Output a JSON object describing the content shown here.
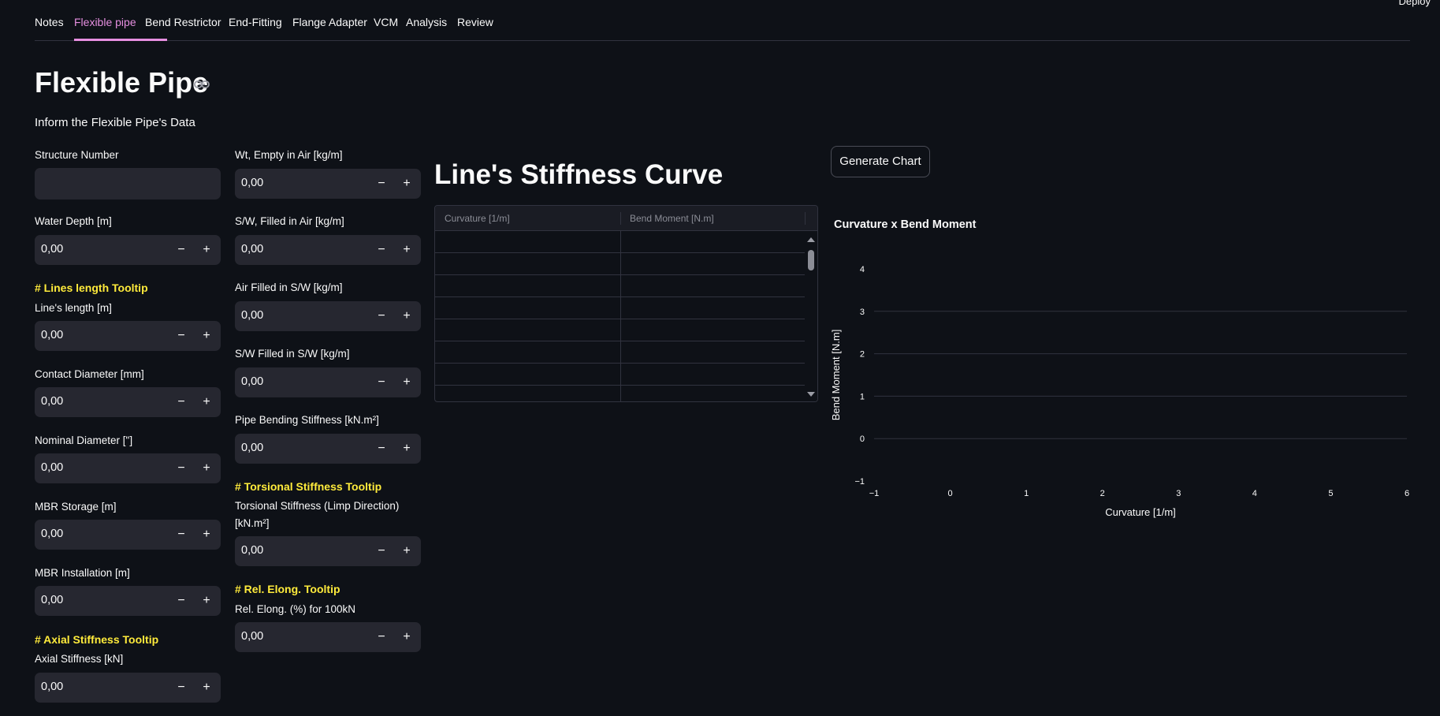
{
  "header": {
    "deploy": "Deploy"
  },
  "tabs": [
    {
      "label": "Notes",
      "active": false
    },
    {
      "label": "Flexible pipe",
      "active": true
    },
    {
      "label": "Bend Restrictor",
      "active": false
    },
    {
      "label": "End-Fitting",
      "active": false
    },
    {
      "label": "Flange Adapter",
      "active": false
    },
    {
      "label": "VCM",
      "active": false
    },
    {
      "label": "Analysis",
      "active": false
    },
    {
      "label": "Review",
      "active": false
    }
  ],
  "page": {
    "title": "Flexible Pipe",
    "subtitle": "Inform the Flexible Pipe's Data"
  },
  "left_fields": {
    "structure_number": {
      "label": "Structure Number",
      "value": ""
    },
    "water_depth": {
      "label": "Water Depth [m]",
      "value": "0,00"
    },
    "lines_tooltip": "# Lines length Tooltip",
    "lines_length": {
      "label": "Line's length [m]",
      "value": "0,00"
    },
    "contact_diameter": {
      "label": "Contact Diameter [mm]",
      "value": "0,00"
    },
    "nominal_diameter": {
      "label": "Nominal Diameter [\"]",
      "value": "0,00"
    },
    "mbr_storage": {
      "label": "MBR Storage [m]",
      "value": "0,00"
    },
    "mbr_installation": {
      "label": "MBR Installation [m]",
      "value": "0,00"
    },
    "axial_tooltip": "# Axial Stiffness Tooltip",
    "axial_stiffness": {
      "label": "Axial Stiffness [kN]",
      "value": "0,00"
    }
  },
  "right_fields": {
    "wt_empty_air": {
      "label": "Wt, Empty in Air [kg/m]",
      "value": "0,00"
    },
    "sw_filled_air": {
      "label": "S/W, Filled in Air [kg/m]",
      "value": "0,00"
    },
    "air_filled_sw": {
      "label": "Air Filled in S/W [kg/m]",
      "value": "0,00"
    },
    "sw_filled_sw": {
      "label": "S/W Filled in S/W [kg/m]",
      "value": "0,00"
    },
    "bending_stiffness": {
      "label": "Pipe Bending Stiffness [kN.m²]",
      "value": "0,00"
    },
    "torsional_tooltip": "# Torsional Stiffness Tooltip",
    "torsional_stiffness": {
      "label_line1": "Torsional Stiffness (Limp Direction)",
      "label_line2": "[kN.m²]",
      "value": "0,00"
    },
    "rel_elong_tooltip": "# Rel. Elong. Tooltip",
    "rel_elong": {
      "label": "Rel. Elong. (%) for 100kN",
      "value": "0,00"
    }
  },
  "buttons": {
    "minus": "−",
    "plus": "+",
    "generate_chart": "Generate Chart"
  },
  "stiffness": {
    "title": "Line's Stiffness Curve",
    "columns": [
      "Curvature [1/m]",
      "Bend Moment [N.m]"
    ]
  },
  "chart_data": {
    "type": "line",
    "title": "Curvature x Bend Moment",
    "xlabel": "Curvature [1/m]",
    "ylabel": "Bend Moment [N.m]",
    "x": [],
    "series": [],
    "xlim": [
      -1,
      6
    ],
    "ylim": [
      -1,
      4
    ],
    "xticks": [
      "−1",
      "0",
      "1",
      "2",
      "3",
      "4",
      "5",
      "6"
    ],
    "yticks": [
      "−1",
      "0",
      "1",
      "2",
      "3",
      "4"
    ],
    "grid": true
  },
  "colors": {
    "background": "#0e1117",
    "input": "#262730",
    "accent": "#e68fe0",
    "tooltip": "#ffeb3b"
  }
}
